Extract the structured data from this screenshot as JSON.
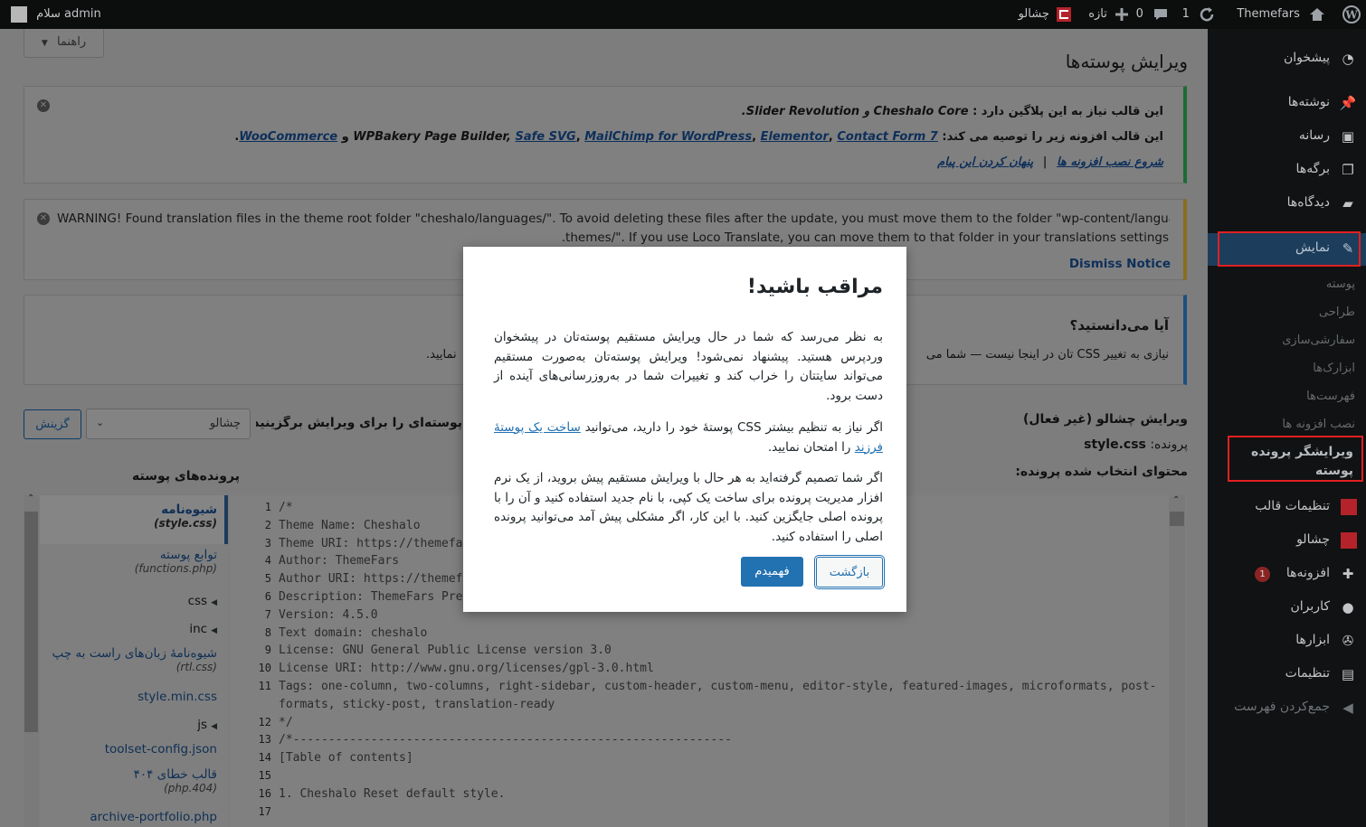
{
  "adminbar": {
    "site_name": "Themefars",
    "updates_count": "1",
    "comments_count": "0",
    "new_label": "تازه",
    "theme_label": "چشالو",
    "greeting": "سلام admin"
  },
  "sidebar": {
    "items": [
      {
        "label": "پیشخوان",
        "icon": "dashboard-icon"
      },
      {
        "label": "نوشته‌ها",
        "icon": "pin-icon"
      },
      {
        "label": "رسانه",
        "icon": "media-icon"
      },
      {
        "label": "برگه‌ها",
        "icon": "pages-icon"
      },
      {
        "label": "دیدگاه‌ها",
        "icon": "comments-icon"
      },
      {
        "label": "نمایش",
        "icon": "brush-icon"
      },
      {
        "label": "تنظیمات قالب",
        "icon": "theme-settings-icon"
      },
      {
        "label": "چشالو",
        "icon": "cheshalo-icon"
      },
      {
        "label": "افزونه‌ها",
        "icon": "plugins-icon",
        "badge": "1"
      },
      {
        "label": "کاربران",
        "icon": "users-icon"
      },
      {
        "label": "ابزارها",
        "icon": "tools-icon"
      },
      {
        "label": "تنظیمات",
        "icon": "settings-icon"
      },
      {
        "label": "جمع‌کردن فهرست",
        "icon": "collapse-icon"
      }
    ],
    "submenu": [
      "پوسته",
      "طراحی",
      "سفارشی‌سازی",
      "ابزارک‌ها",
      "فهرست‌ها",
      "نصب افزونه ها",
      "ویرایشگر پرونده پوسته"
    ]
  },
  "main": {
    "help_button": "راهنما",
    "page_title": "ویرایش پوسته‌ها",
    "notice1": {
      "line1_prefix": "این قالب نیاز به این پلاگین دارد :",
      "line1_plugins": "Cheshalo Core و Slider Revolution.",
      "line2_prefix": "این قالب افزونه زیر را توصیه می کند:",
      "line2_plain": "WPBakery Page Builder,",
      "links": [
        "Safe SVG",
        "MailChimp for WordPress",
        "Elementor",
        "Contact Form 7",
        "WooCommerce"
      ],
      "and": "و",
      "action_install": "شروع نصب افزونه ها",
      "action_dismiss": "پنهان کردن این پیام",
      "separator": "|"
    },
    "notice2": {
      "line1": "WARNING! Found translation files in the theme root folder \"cheshalo/languages/\". To avoid deleting these files after the update, you must move them to the folder \"wp-content/languages/",
      "line2": "themes/\". If you use Loco Translate, you can move them to that folder in your translations settings.",
      "dismiss": "Dismiss Notice"
    },
    "notice3": {
      "title": "آیا می‌دانستید؟",
      "text_right": "نیازی به تغییر CSS تان در اینجا نیست — شما می",
      "text_left": "نمایید."
    },
    "edit_heading": "ویرایش چشالو (غیر فعال)",
    "file_label": "پرونده:",
    "file_name": "style.css",
    "content_label": "محتوای انتخاب شده پرونده:",
    "select_label": "پوسته‌ای را برای ویرایش برگزینید:",
    "select_value": "چشالو",
    "select_button": "گزینش",
    "theme_files_heading": "پرونده‌های پوسته",
    "files": [
      {
        "name": "شیوه‌نامه",
        "sub": "(style.css)"
      },
      {
        "name": "توابع پوسته",
        "sub": "(functions.php)"
      },
      {
        "name": "css",
        "folder": true
      },
      {
        "name": "inc",
        "folder": true
      },
      {
        "name": "شیوه‌نامهٔ زبان‌های راست به چپ",
        "sub": "(rtl.css)"
      },
      {
        "name": "style.min.css"
      },
      {
        "name": "js",
        "folder": true
      },
      {
        "name": "toolset-config.json"
      },
      {
        "name": "قالب خطای ۴۰۴",
        "sub": "(php.404)"
      },
      {
        "name": "archive-portfolio.php"
      }
    ],
    "code_lines": [
      {
        "n": "1",
        "t": "/*"
      },
      {
        "n": "2",
        "t": "Theme Name: Cheshalo"
      },
      {
        "n": "3",
        "t": "Theme URI: https://themefa"
      },
      {
        "n": "4",
        "t": "Author: ThemeFars"
      },
      {
        "n": "5",
        "t": "Author URI: https://themef"
      },
      {
        "n": "6",
        "t": "Description: ThemeFars Pre"
      },
      {
        "n": "7",
        "t": "Version: 4.5.0"
      },
      {
        "n": "8",
        "t": "Text domain: cheshalo"
      },
      {
        "n": "9",
        "t": "License: GNU General Public License version 3.0"
      },
      {
        "n": "10",
        "t": "License URI: http://www.gnu.org/licenses/gpl-3.0.html"
      },
      {
        "n": "11",
        "t": "Tags: one-column, two-columns, right-sidebar, custom-header, custom-menu, editor-style, featured-images, microformats, post-"
      },
      {
        "n": "",
        "t": "formats, sticky-post, translation-ready"
      },
      {
        "n": "12",
        "t": "*/"
      },
      {
        "n": "13",
        "t": "/*--------------------------------------------------------------"
      },
      {
        "n": "14",
        "t": "[Table of contents]"
      },
      {
        "n": "15",
        "t": ""
      },
      {
        "n": "16",
        "t": "1. Cheshalo Reset default style."
      },
      {
        "n": "17",
        "t": ""
      }
    ]
  },
  "modal": {
    "title": "مراقب باشید!",
    "p1": "به نظر می‌رسد که شما در حال ویرایش مستقیم پوسته‌تان در پیشخوان وردپرس هستید. پیشنهاد نمی‌شود! ویرایش پوسته‌تان به‌صورت مستقیم می‌تواند سایتتان را خراب کند و تغییرات شما در به‌روزرسانی‌های آینده از دست برود.",
    "p2_before": "اگر نیاز به تنظیم بیشتر CSS پوستهٔ خود را دارید، می‌توانید",
    "p2_link": "ساخت یک پوستهٔ فرزند",
    "p2_after": "را امتحان نمایید.",
    "p3": "اگر شما تصمیم گرفته‌اید به هر حال با ویرایش مستقیم پیش بروید، از یک نرم افزار مدیریت پرونده برای ساخت یک کپی، با نام جدید استفاده کنید و آن را با پرونده اصلی جایگزین کنید. با این کار، اگر مشکلی پیش آمد می‌توانید پرونده اصلی را استفاده کنید.",
    "confirm_button": "فهمیدم",
    "back_button": "بازگشت"
  }
}
